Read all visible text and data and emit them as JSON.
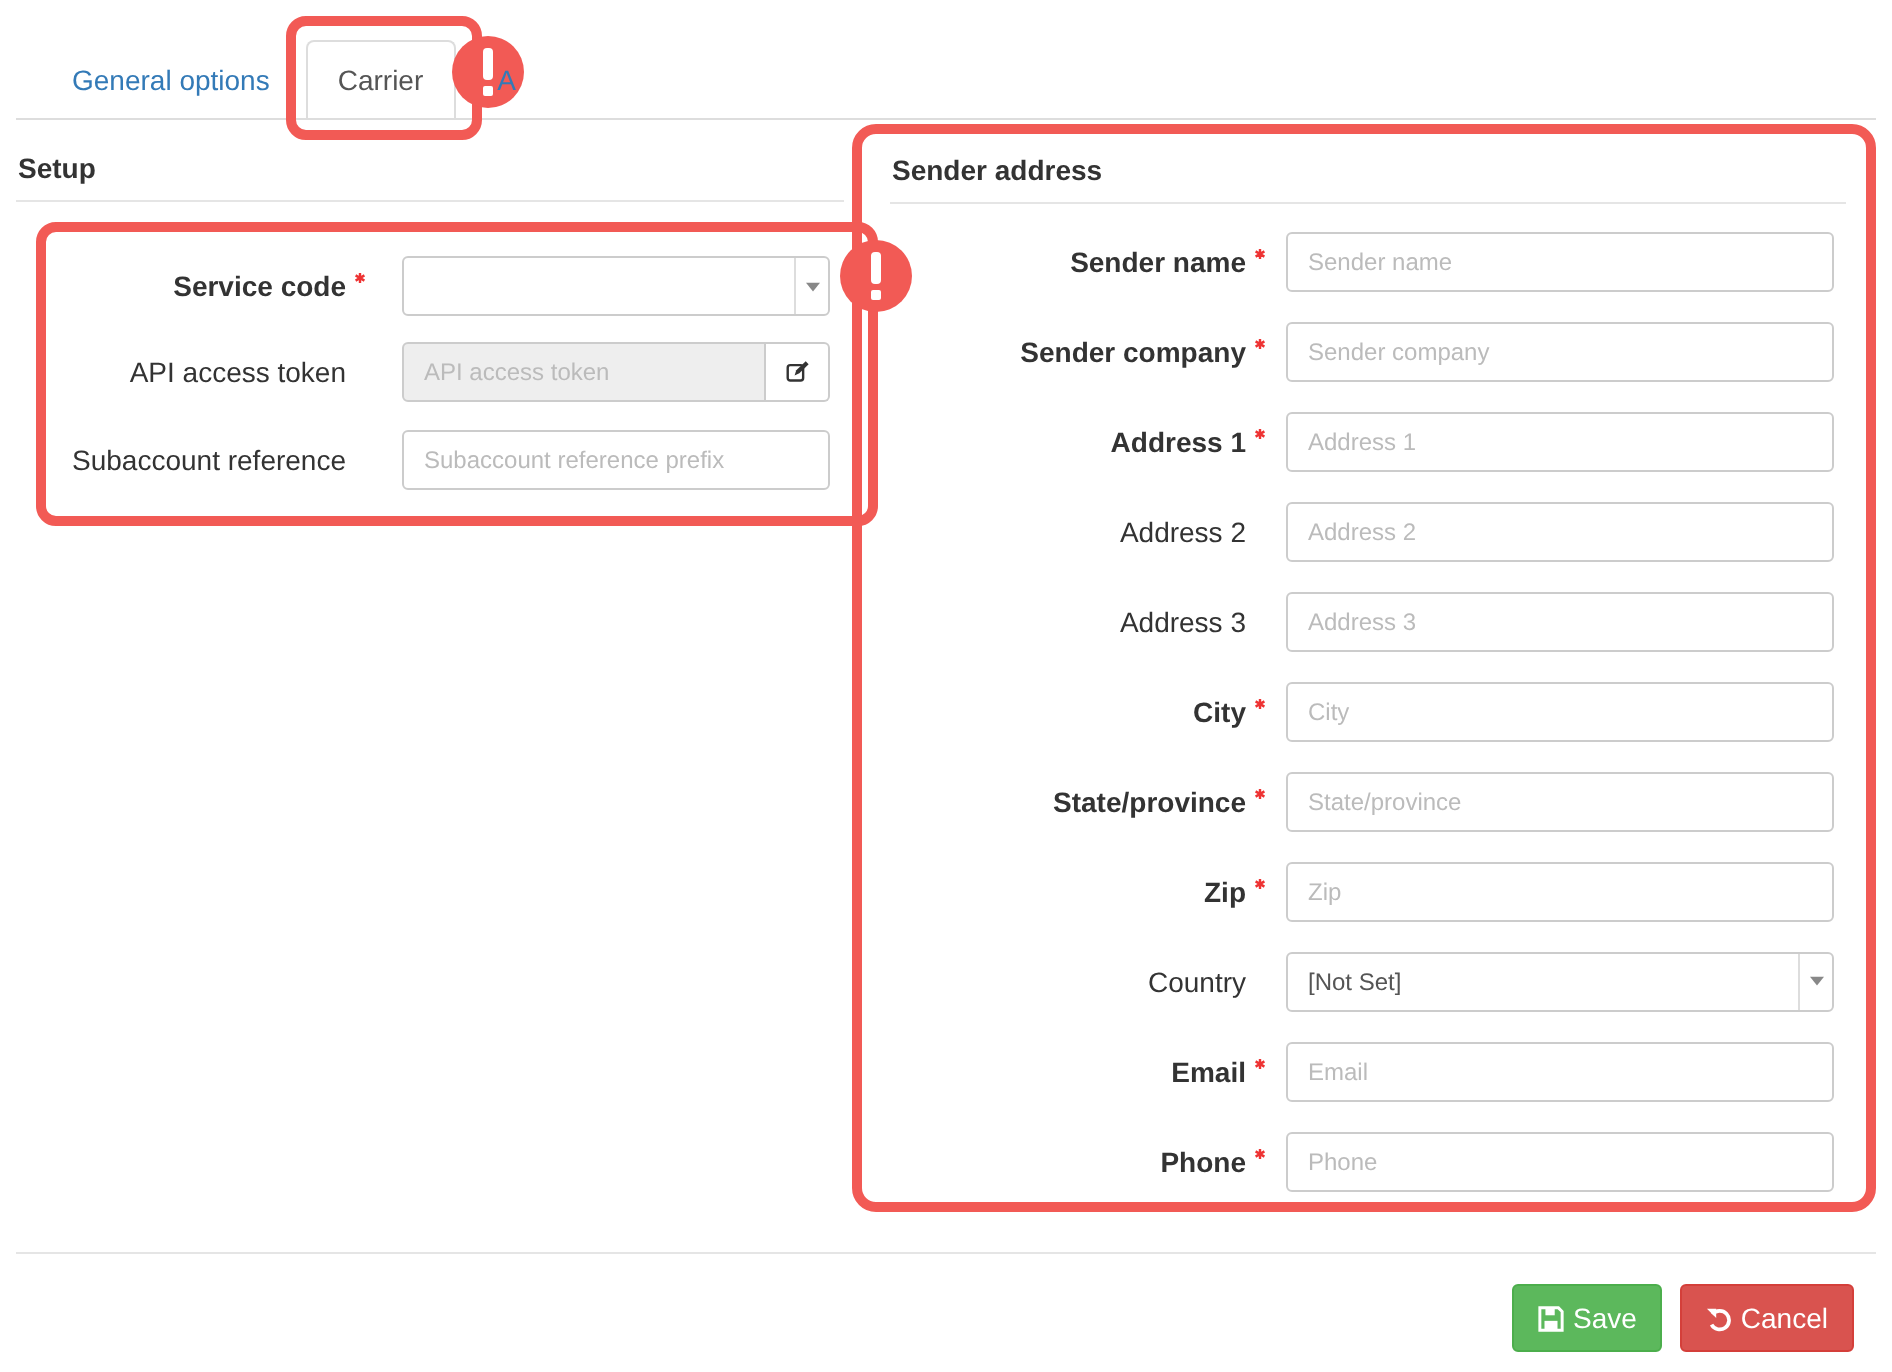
{
  "tabs": [
    {
      "label": "General options",
      "selected": false,
      "highlight": false,
      "alert": false
    },
    {
      "label": "Carrier",
      "selected": true,
      "highlight": true,
      "alert": true
    },
    {
      "label": "A",
      "selected": false,
      "highlight": false,
      "alert": false
    }
  ],
  "setup": {
    "title": "Setup",
    "highlight": true,
    "alert": true,
    "fields": [
      {
        "label": "Service code",
        "required": true,
        "kind": "select"
      },
      {
        "label": "API access token",
        "required": false,
        "kind": "token",
        "placeholder": "API access token",
        "disabled": true
      },
      {
        "label": "Subaccount reference",
        "required": false,
        "kind": "text",
        "placeholder": "Subaccount reference prefix",
        "disabled": false
      }
    ]
  },
  "sender": {
    "title": "Sender address",
    "highlight": true,
    "alert": false,
    "fields": [
      {
        "label": "Sender name",
        "required": true,
        "kind": "text",
        "placeholder": "Sender name",
        "disabled": false
      },
      {
        "label": "Sender company",
        "required": true,
        "kind": "text",
        "placeholder": "Sender company",
        "disabled": false
      },
      {
        "label": "Address 1",
        "required": true,
        "kind": "text",
        "placeholder": "Address 1",
        "disabled": false
      },
      {
        "label": "Address 2",
        "required": false,
        "kind": "text",
        "placeholder": "Address 2",
        "disabled": false
      },
      {
        "label": "Address 3",
        "required": false,
        "kind": "text",
        "placeholder": "Address 3",
        "disabled": false
      },
      {
        "label": "City",
        "required": true,
        "kind": "text",
        "placeholder": "City",
        "disabled": false
      },
      {
        "label": "State/province",
        "required": true,
        "kind": "text",
        "placeholder": "State/province",
        "disabled": false
      },
      {
        "label": "Zip",
        "required": true,
        "kind": "text",
        "placeholder": "Zip",
        "disabled": false
      },
      {
        "label": "Country",
        "required": false,
        "kind": "select",
        "value": "[Not Set]"
      },
      {
        "label": "Email",
        "required": true,
        "kind": "text",
        "placeholder": "Email",
        "disabled": false
      },
      {
        "label": "Phone",
        "required": true,
        "kind": "text",
        "placeholder": "Phone",
        "disabled": false
      }
    ]
  },
  "buttons": [
    {
      "label": "Save",
      "kind": "save"
    },
    {
      "label": "Cancel",
      "kind": "cancel"
    }
  ]
}
